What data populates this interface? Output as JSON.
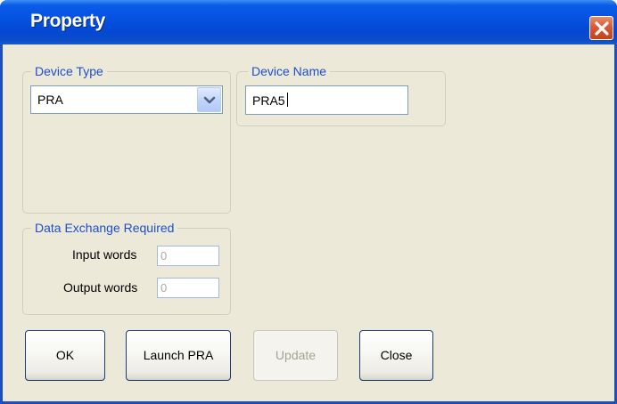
{
  "window": {
    "title": "Property"
  },
  "device_type": {
    "legend": "Device Type",
    "selected": "PRA"
  },
  "device_name": {
    "legend": "Device Name",
    "value": "PRA5"
  },
  "data_exchange": {
    "legend": "Data Exchange Required",
    "input_label": "Input words",
    "input_value": "0",
    "output_label": "Output words",
    "output_value": "0"
  },
  "buttons": {
    "ok": "OK",
    "launch": "Launch PRA",
    "update": "Update",
    "close": "Close"
  },
  "colors": {
    "title_bar": "#0553e0",
    "window_bg": "#ece9d8",
    "legend_text": "#1c4fcf",
    "close_button": "#d75a34"
  }
}
